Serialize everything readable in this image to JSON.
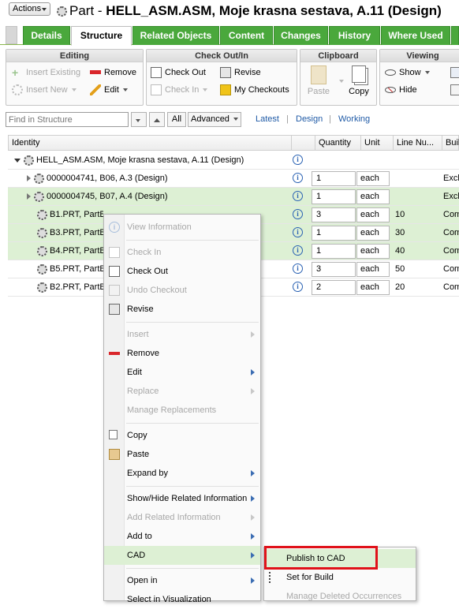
{
  "header": {
    "actions_label": "Actions",
    "title_prefix": "Part - ",
    "title_bold": "HELL_ASM.ASM, Moje krasna sestava, A.11 (Design)"
  },
  "tabs": [
    "Details",
    "Structure",
    "Related Objects",
    "Content",
    "Changes",
    "History",
    "Where Used"
  ],
  "active_tab": "Structure",
  "ribbon": {
    "editing": {
      "title": "Editing",
      "insert_existing": "Insert Existing",
      "insert_new": "Insert New",
      "remove": "Remove",
      "edit": "Edit"
    },
    "checkout": {
      "title": "Check Out/In",
      "check_out": "Check Out",
      "check_in": "Check In",
      "revise": "Revise",
      "my_checkouts": "My Checkouts"
    },
    "clipboard": {
      "title": "Clipboard",
      "paste": "Paste",
      "copy": "Copy"
    },
    "viewing": {
      "title": "Viewing",
      "show": "Show",
      "hide": "Hide"
    }
  },
  "findbar": {
    "placeholder": "Find in Structure",
    "all": "All",
    "advanced": "Advanced",
    "latest": "Latest",
    "design": "Design",
    "working": "Working"
  },
  "table": {
    "headers": [
      "Identity",
      "Quantity",
      "Unit",
      "Line Nu...",
      "Buil"
    ],
    "rows": [
      {
        "identity": "HELL_ASM.ASM, Moje krasna sestava, A.11 (Design)",
        "qty": "",
        "unit": "",
        "line": "",
        "build": ""
      },
      {
        "identity": "0000004741, B06, A.3 (Design)",
        "qty": "1",
        "unit": "each",
        "line": "",
        "build": "Excl"
      },
      {
        "identity": "0000004745, B07, A.4 (Design)",
        "qty": "1",
        "unit": "each",
        "line": "",
        "build": "Excl"
      },
      {
        "identity": "B1.PRT, PartB1, A.3 (Design)",
        "qty": "3",
        "unit": "each",
        "line": "10",
        "build": "Com"
      },
      {
        "identity": "B3.PRT, PartB3",
        "qty": "1",
        "unit": "each",
        "line": "30",
        "build": "Com"
      },
      {
        "identity": "B4.PRT, PartB4",
        "qty": "1",
        "unit": "each",
        "line": "40",
        "build": "Com"
      },
      {
        "identity": "B5.PRT, PartB5",
        "qty": "3",
        "unit": "each",
        "line": "50",
        "build": "Com"
      },
      {
        "identity": "B2.PRT, PartB2",
        "qty": "2",
        "unit": "each",
        "line": "20",
        "build": "Com"
      }
    ]
  },
  "context_menu": {
    "view_information": "View Information",
    "check_in": "Check In",
    "check_out": "Check Out",
    "undo_checkout": "Undo Checkout",
    "revise": "Revise",
    "insert": "Insert",
    "remove": "Remove",
    "edit": "Edit",
    "replace": "Replace",
    "manage_replacements": "Manage Replacements",
    "copy": "Copy",
    "paste": "Paste",
    "expand_by": "Expand by",
    "show_hide_related": "Show/Hide Related Information",
    "add_related": "Add Related Information",
    "add_to": "Add to",
    "cad": "CAD",
    "open_in": "Open in",
    "select_in_visualization": "Select in Visualization"
  },
  "cad_submenu": {
    "publish_to_cad": "Publish to CAD",
    "set_for_build": "Set for Build",
    "manage_deleted": "Manage Deleted Occurrences"
  },
  "colors": {
    "tab_green": "#4aa83c",
    "highlight_green": "#ddf0d4",
    "link_blue": "#1f5aa6",
    "red_box": "#e0121a"
  }
}
